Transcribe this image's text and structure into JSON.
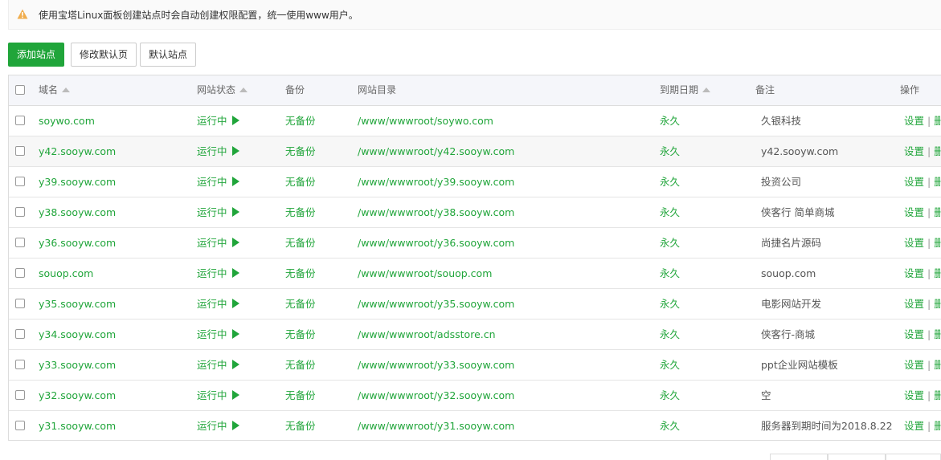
{
  "notice": {
    "text": "使用宝塔Linux面板创建站点时会自动创建权限配置，统一使用www用户。",
    "icon": "warning-icon"
  },
  "toolbar": {
    "add_site": "添加站点",
    "edit_default_page": "修改默认页",
    "default_site": "默认站点"
  },
  "columns": {
    "domain": "域名",
    "status": "网站状态",
    "backup": "备份",
    "path": "网站目录",
    "expire": "到期日期",
    "note": "备注",
    "ops": "操作"
  },
  "rows": [
    {
      "domain": "soywo.com",
      "status": "运行中",
      "backup": "无备份",
      "path": "/www/wwwroot/soywo.com",
      "expire": "永久",
      "note": "久银科技",
      "op_settings": "设置",
      "op_delete": "删"
    },
    {
      "domain": "y42.sooyw.com",
      "status": "运行中",
      "backup": "无备份",
      "path": "/www/wwwroot/y42.sooyw.com",
      "expire": "永久",
      "note": "y42.sooyw.com",
      "op_settings": "设置",
      "op_delete": "删"
    },
    {
      "domain": "y39.sooyw.com",
      "status": "运行中",
      "backup": "无备份",
      "path": "/www/wwwroot/y39.sooyw.com",
      "expire": "永久",
      "note": "投资公司",
      "op_settings": "设置",
      "op_delete": "删"
    },
    {
      "domain": "y38.sooyw.com",
      "status": "运行中",
      "backup": "无备份",
      "path": "/www/wwwroot/y38.sooyw.com",
      "expire": "永久",
      "note": "侠客行 简单商城",
      "op_settings": "设置",
      "op_delete": "删"
    },
    {
      "domain": "y36.sooyw.com",
      "status": "运行中",
      "backup": "无备份",
      "path": "/www/wwwroot/y36.sooyw.com",
      "expire": "永久",
      "note": "尚捷名片源码",
      "op_settings": "设置",
      "op_delete": "删"
    },
    {
      "domain": "souop.com",
      "status": "运行中",
      "backup": "无备份",
      "path": "/www/wwwroot/souop.com",
      "expire": "永久",
      "note": "souop.com",
      "op_settings": "设置",
      "op_delete": "删"
    },
    {
      "domain": "y35.sooyw.com",
      "status": "运行中",
      "backup": "无备份",
      "path": "/www/wwwroot/y35.sooyw.com",
      "expire": "永久",
      "note": "电影网站开发",
      "op_settings": "设置",
      "op_delete": "删"
    },
    {
      "domain": "y34.sooyw.com",
      "status": "运行中",
      "backup": "无备份",
      "path": "/www/wwwroot/adsstore.cn",
      "expire": "永久",
      "note": "侠客行-商城",
      "op_settings": "设置",
      "op_delete": "删"
    },
    {
      "domain": "y33.sooyw.com",
      "status": "运行中",
      "backup": "无备份",
      "path": "/www/wwwroot/y33.sooyw.com",
      "expire": "永久",
      "note": "ppt企业网站模板",
      "op_settings": "设置",
      "op_delete": "删"
    },
    {
      "domain": "y32.sooyw.com",
      "status": "运行中",
      "backup": "无备份",
      "path": "/www/wwwroot/y32.sooyw.com",
      "expire": "永久",
      "note": "空",
      "op_settings": "设置",
      "op_delete": "删"
    },
    {
      "domain": "y31.sooyw.com",
      "status": "运行中",
      "backup": "无备份",
      "path": "/www/wwwroot/y31.sooyw.com",
      "expire": "永久",
      "note": "服务器到期时间为2018.8.22",
      "op_settings": "设置",
      "op_delete": "删"
    }
  ],
  "colors": {
    "accent": "#20a53a",
    "warning": "#f0ad4e"
  }
}
